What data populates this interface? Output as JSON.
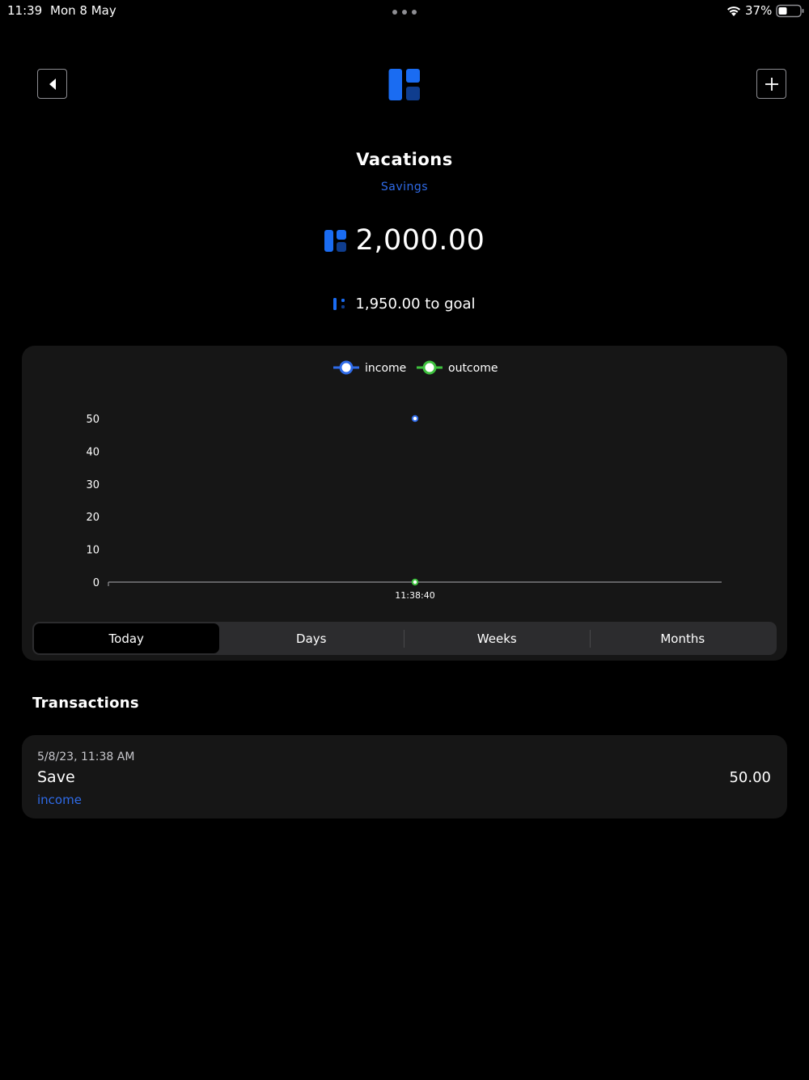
{
  "status_bar": {
    "time": "11:39",
    "date": "Mon 8 May",
    "battery": "37%"
  },
  "header": {
    "title": "Vacations",
    "subtitle": "Savings"
  },
  "balance": {
    "amount": "2,000.00",
    "to_goal": "1,950.00 to goal"
  },
  "colors": {
    "accent": "#2f6be8",
    "income": "#2f6be8",
    "outcome": "#3ec13e",
    "card": "#161616"
  },
  "chart_data": {
    "type": "line",
    "x": [
      "11:38:40"
    ],
    "series": [
      {
        "name": "income",
        "values": [
          50
        ]
      },
      {
        "name": "outcome",
        "values": [
          0
        ]
      }
    ],
    "yticks": [
      0,
      10,
      20,
      30,
      40,
      50
    ],
    "ylim": [
      0,
      50
    ],
    "grid": false,
    "legend": "top-center"
  },
  "range_tabs": [
    "Today",
    "Days",
    "Weeks",
    "Months"
  ],
  "range_selected": 0,
  "transactions_title": "Transactions",
  "transactions": [
    {
      "date": "5/8/23, 11:38 AM",
      "name": "Save",
      "type": "income",
      "amount": "50.00"
    }
  ]
}
